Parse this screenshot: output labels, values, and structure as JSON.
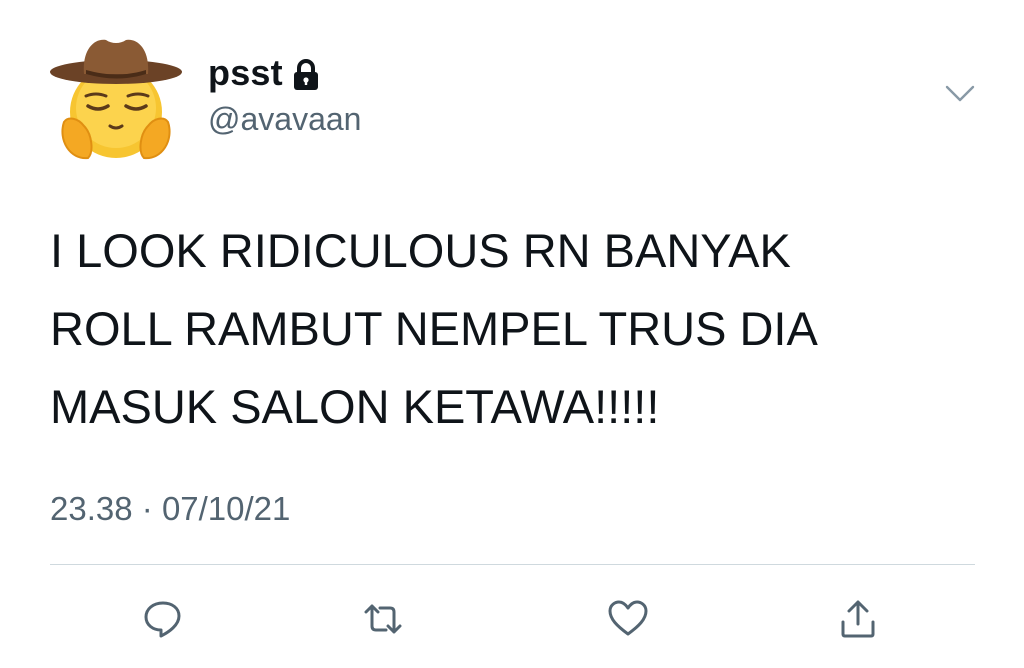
{
  "tweet": {
    "display_name": "psst",
    "handle": "@avavaan",
    "text_lines": [
      "I LOOK RIDICULOUS RN BANYAK",
      "ROLL RAMBUT NEMPEL TRUS DIA",
      "MASUK SALON KETAWA!!!!!"
    ],
    "time": "23.38",
    "separator": "·",
    "date": "07/10/21"
  },
  "icons": {
    "avatar": "cowboy-pleading-emoji",
    "protected": "lock-icon",
    "menu": "chevron-down-icon",
    "actions": [
      "reply-icon",
      "retweet-icon",
      "like-icon",
      "share-icon"
    ]
  },
  "colors": {
    "text_primary": "#0f1419",
    "text_secondary": "#536471",
    "icon_gray": "#536471",
    "divider": "#cfd9de"
  }
}
